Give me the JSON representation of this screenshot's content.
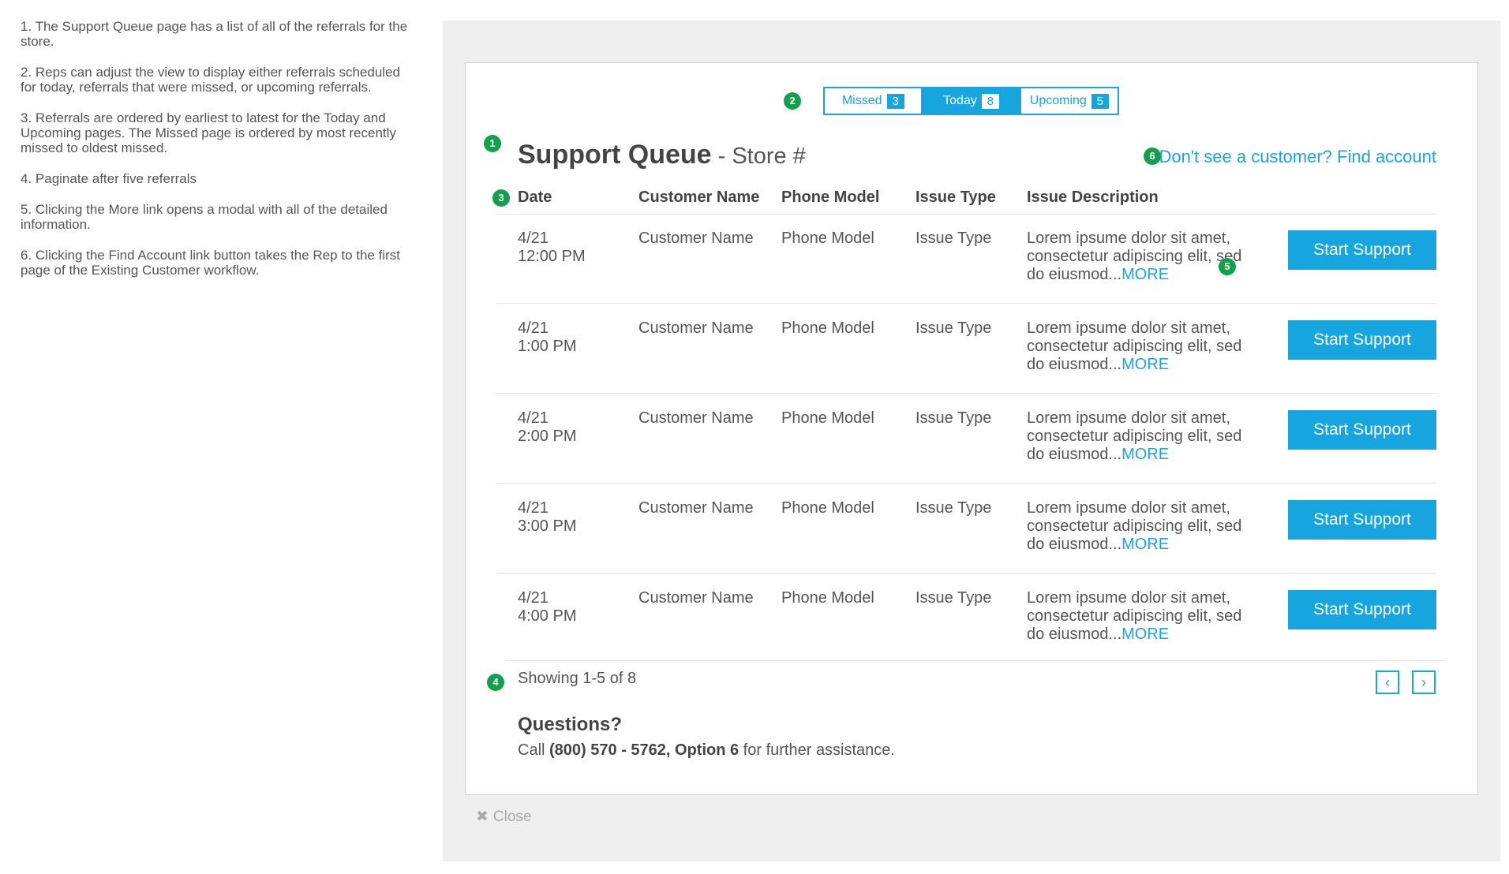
{
  "notes": [
    "1. The Support Queue page has a list of all of the referrals for the store.",
    "2. Reps can adjust the view to display either referrals scheduled for today, referrals that were missed, or upcoming referrals.",
    "3. Referrals are ordered by earliest to latest for the Today and Upcoming pages. The Missed page is ordered by most recently missed to oldest missed.",
    "4. Paginate after five referrals",
    "5. Clicking the More link opens a modal with all of the detailed information.",
    "6. Clicking the Find Account link button takes the Rep to the first page of the Existing Customer workflow."
  ],
  "badges": [
    "1",
    "2",
    "3",
    "4",
    "5",
    "6"
  ],
  "tabs": [
    {
      "label": "Missed",
      "count": "3"
    },
    {
      "label": "Today",
      "count": "8"
    },
    {
      "label": "Upcoming",
      "count": "5"
    }
  ],
  "title": {
    "main": "Support Queue",
    "sub": " - Store #"
  },
  "find_account": "Don't see a customer? Find account",
  "columns": [
    "Date",
    "Customer Name",
    "Phone Model",
    "Issue Type",
    "Issue Description"
  ],
  "rows": [
    {
      "date": "4/21",
      "time": "12:00 PM",
      "name": "Customer Name",
      "model": "Phone Model",
      "type": "Issue Type",
      "desc": "Lorem ipsume dolor sit amet, consectetur adipiscing elit, sed do eiusmod...",
      "more": "MORE",
      "button": "Start Support"
    },
    {
      "date": "4/21",
      "time": "1:00 PM",
      "name": "Customer Name",
      "model": "Phone Model",
      "type": "Issue Type",
      "desc": "Lorem ipsume dolor sit amet, consectetur adipiscing elit, sed do eiusmod...",
      "more": "MORE",
      "button": "Start Support"
    },
    {
      "date": "4/21",
      "time": "2:00 PM",
      "name": "Customer Name",
      "model": "Phone Model",
      "type": "Issue Type",
      "desc": "Lorem ipsume dolor sit amet, consectetur adipiscing elit, sed do eiusmod...",
      "more": "MORE",
      "button": "Start Support"
    },
    {
      "date": "4/21",
      "time": "3:00 PM",
      "name": "Customer Name",
      "model": "Phone Model",
      "type": "Issue Type",
      "desc": "Lorem ipsume dolor sit amet, consectetur adipiscing elit, sed do eiusmod...",
      "more": "MORE",
      "button": "Start Support"
    },
    {
      "date": "4/21",
      "time": "4:00 PM",
      "name": "Customer Name",
      "model": "Phone Model",
      "type": "Issue Type",
      "desc": "Lorem ipsume dolor sit amet, consectetur adipiscing elit, sed do eiusmod...",
      "more": "MORE",
      "button": "Start Support"
    }
  ],
  "pagination": {
    "showing": "Showing 1-5 of 8",
    "prev": "‹",
    "next": "›"
  },
  "questions": {
    "heading": "Questions?",
    "prefix": "Call ",
    "phone": "(800) 570 - 5762, Option 6",
    "suffix": " for further assistance."
  },
  "close": {
    "icon": "✖",
    "label": "Close"
  },
  "colors": {
    "accent": "#17a5df",
    "badge": "#11a04b",
    "panel": "#efefef"
  }
}
